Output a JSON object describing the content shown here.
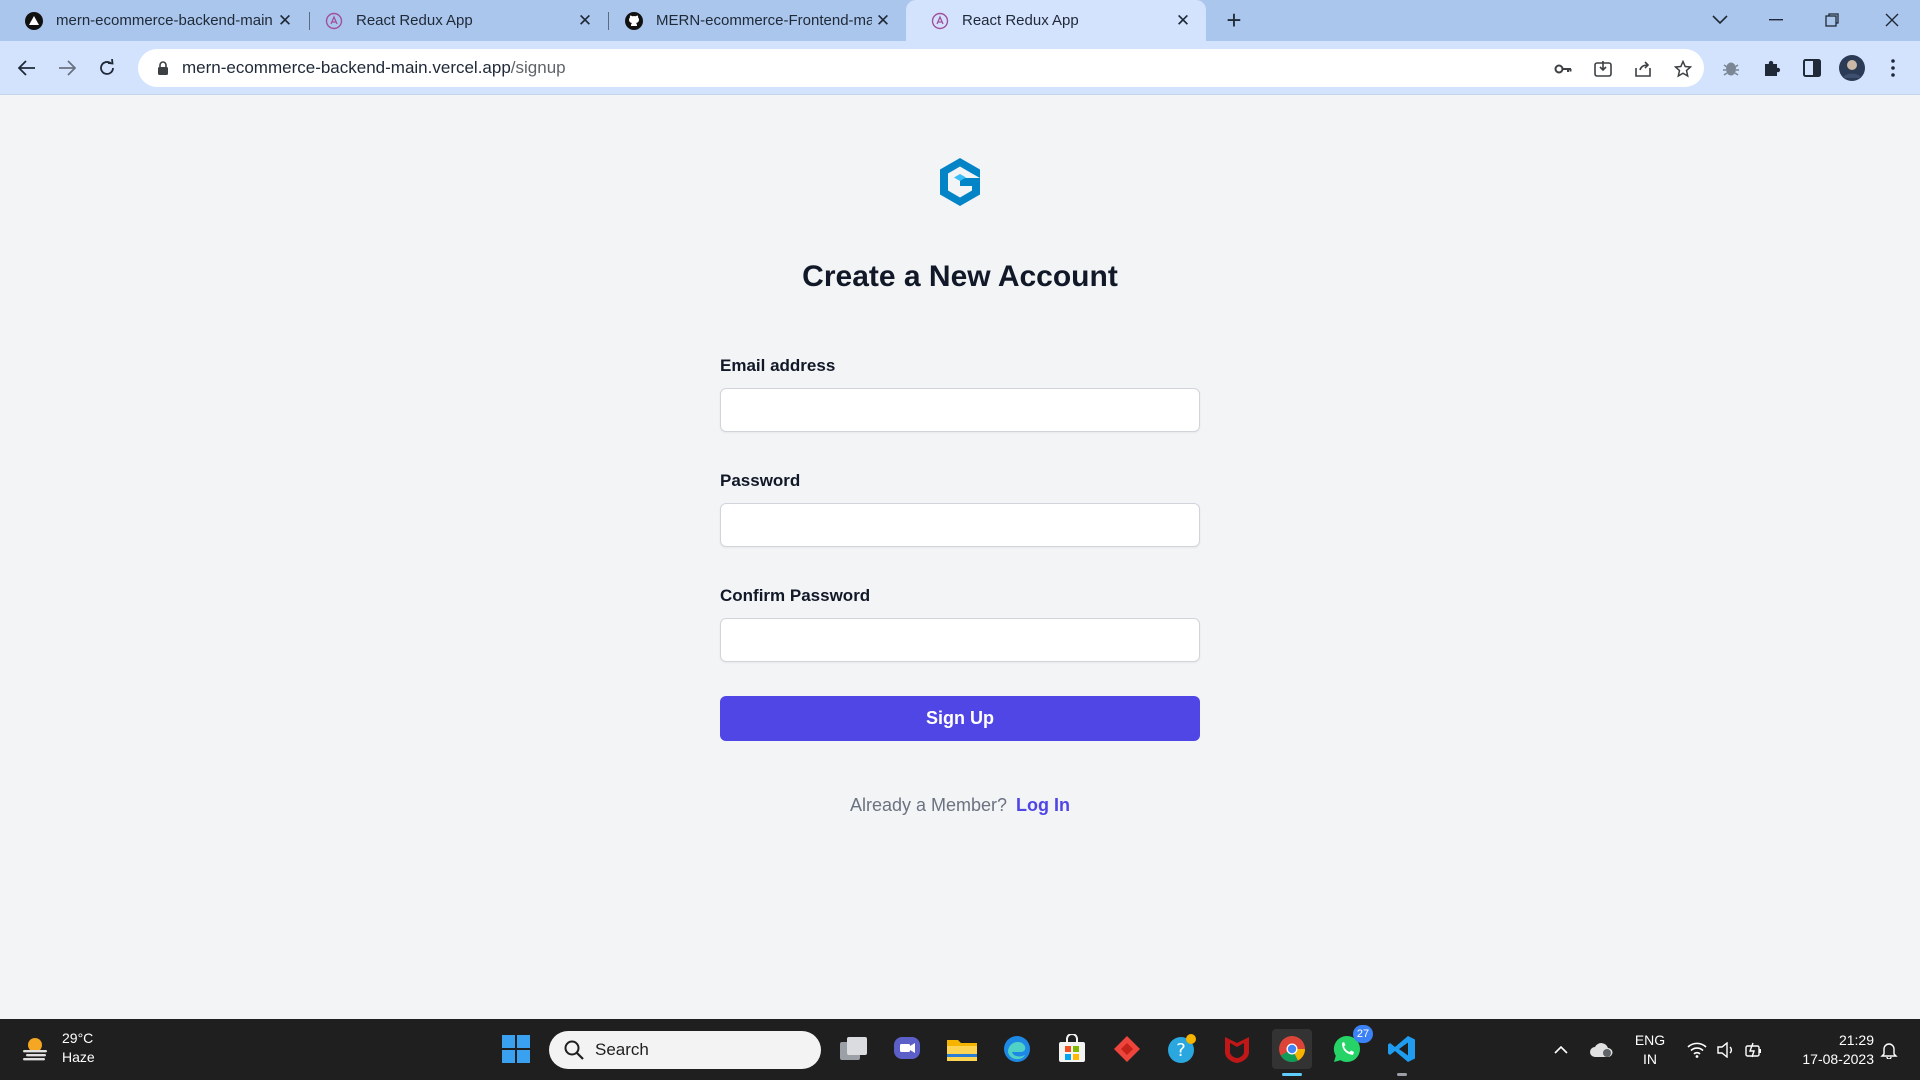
{
  "browser": {
    "tabs": [
      {
        "title": "mern-ecommerce-backend-main.vercel.app",
        "icon": "vercel-icon",
        "active": false
      },
      {
        "title": "React Redux App",
        "icon": "react-icon",
        "active": false
      },
      {
        "title": "MERN-ecommerce-Frontend-main",
        "icon": "github-icon",
        "active": false
      },
      {
        "title": "React Redux App",
        "icon": "react-icon",
        "active": true
      }
    ],
    "url_host": "mern-ecommerce-backend-main.vercel.app",
    "url_path": "/signup"
  },
  "page": {
    "heading": "Create a New Account",
    "fields": [
      {
        "label": "Email address",
        "value": "",
        "placeholder": ""
      },
      {
        "label": "Password",
        "value": "",
        "placeholder": ""
      },
      {
        "label": "Confirm Password",
        "value": "",
        "placeholder": ""
      }
    ],
    "signup_label": "Sign Up",
    "member_text": "Already a Member?",
    "login_link": "Log In"
  },
  "taskbar": {
    "temperature": "29°C",
    "weather": "Haze",
    "search_placeholder": "Search",
    "whatsapp_badge": "27",
    "lang_line1": "ENG",
    "lang_line2": "IN",
    "time": "21:29",
    "date": "17-08-2023"
  },
  "colors": {
    "primary": "#4f46e5",
    "logo": "#0284c7",
    "tabbar": "#aac6ec",
    "toolbar": "#d3e3fd"
  }
}
